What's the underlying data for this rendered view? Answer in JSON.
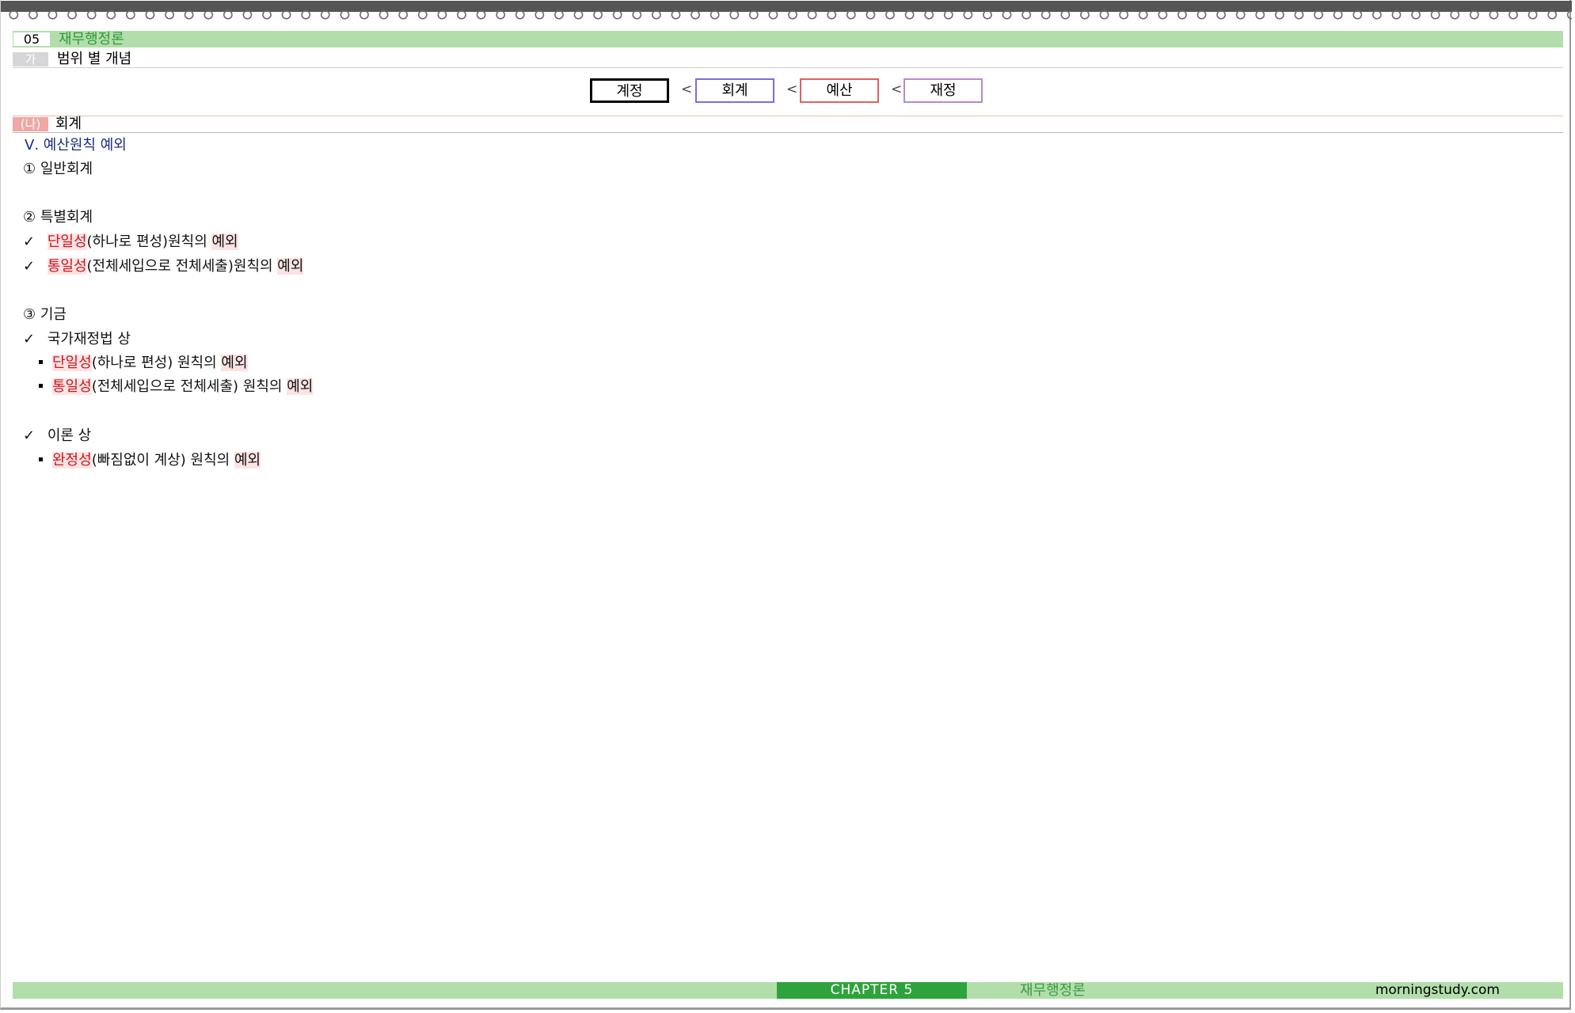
{
  "header": {
    "chapter_number": "05",
    "chapter_title": "재무행정론",
    "section_tag": "가",
    "section_title": "범위 별 개념"
  },
  "hierarchy": {
    "items": [
      "계정",
      "회계",
      "예산",
      "재정"
    ],
    "separator": "<",
    "colors": [
      "#000000",
      "#7a6ee0",
      "#e06060",
      "#b48ad0"
    ]
  },
  "subsection": {
    "tag": "(나)",
    "title": "회계"
  },
  "content": {
    "heading": "Ⅴ. 예산원칙 예외",
    "items": {
      "i1": "① 일반회계",
      "i2": "② 특별회계",
      "i2a": {
        "mark": "✓",
        "term": "단일성",
        "rest": "(하나로 편성)원칙의 ",
        "exc": "예외"
      },
      "i2b": {
        "mark": "✓",
        "term": "통일성",
        "rest": "(전체세입으로 전체세출)원칙의 ",
        "exc": "예외"
      },
      "i3": "③ 기금",
      "i3a": {
        "mark": "✓",
        "text": "국가재정법 상"
      },
      "i3a1": {
        "term": "단일성",
        "rest": "(하나로 편성) 원칙의 ",
        "exc": "예외"
      },
      "i3a2": {
        "term": "통일성",
        "rest": "(전체세입으로 전체세출) 원칙의 ",
        "exc": "예외"
      },
      "i3b": {
        "mark": "✓",
        "text": "이론 상"
      },
      "i3b1": {
        "term": "완정성",
        "rest": "(빠짐없이 계상) 원칙의 ",
        "exc": "예외"
      }
    }
  },
  "footer": {
    "chapter": "CHAPTER 5",
    "title": "재무행정론",
    "site": "morningstudy.com"
  }
}
